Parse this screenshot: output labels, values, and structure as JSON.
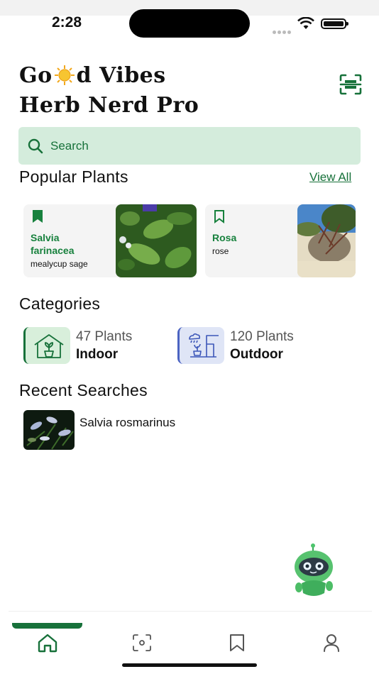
{
  "status_bar": {
    "time": "2:28"
  },
  "header": {
    "title_line1_pre": "Go",
    "title_line1_post": "d Vibes",
    "title_line2": "Herb Nerd Pro",
    "logo_icon": "sun-icon",
    "scan_icon": "scan-icon"
  },
  "search": {
    "placeholder": "Search",
    "icon": "search-icon"
  },
  "popular": {
    "title": "Popular Plants",
    "view_all": "View All",
    "items": [
      {
        "scientific": "Salvia farinacea",
        "common": "mealycup sage",
        "bookmarked": true
      },
      {
        "scientific": "Rosa",
        "common": "rose",
        "bookmarked": false
      }
    ]
  },
  "categories": {
    "title": "Categories",
    "items": [
      {
        "count": "47 Plants",
        "name": "Indoor",
        "icon": "house-plant-icon"
      },
      {
        "count": "120 Plants",
        "name": "Outdoor",
        "icon": "outdoor-plant-icon"
      }
    ]
  },
  "recent": {
    "title": "Recent Searches",
    "items": [
      {
        "name": "Salvia rosmarinus"
      }
    ]
  },
  "tabs": [
    {
      "icon": "home-icon",
      "active": true
    },
    {
      "icon": "scan-camera-icon",
      "active": false
    },
    {
      "icon": "bookmark-icon",
      "active": false
    },
    {
      "icon": "profile-icon",
      "active": false
    }
  ],
  "colors": {
    "brand_green": "#17713a",
    "search_bg": "#d4ecdc",
    "indoor_bg": "#d8efdb",
    "outdoor_bg": "#dfe5f6"
  }
}
